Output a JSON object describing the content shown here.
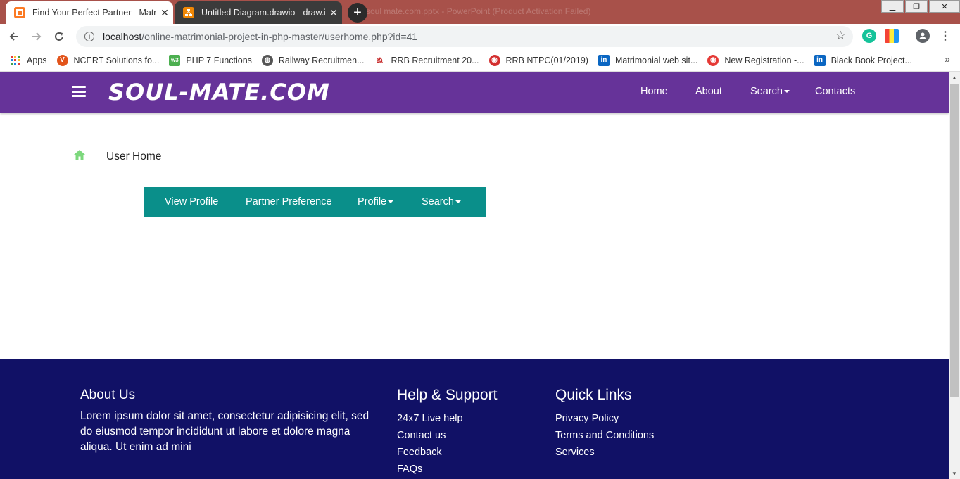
{
  "browser": {
    "tabs": [
      {
        "title": "Find Your Perfect Partner - Matri",
        "icon": "xampp-icon",
        "active": true
      },
      {
        "title": "Untitled Diagram.drawio - draw.i",
        "icon": "drawio-icon",
        "active": false
      }
    ],
    "background_window_title": "soul mate.com.pptx - PowerPoint (Product Activation Failed)",
    "url_host": "localhost",
    "url_path": "/online-matrimonial-project-in-php-master/userhome.php?id=41",
    "bookmarks": [
      {
        "label": "Apps",
        "icon": "apps-grid-icon"
      },
      {
        "label": "NCERT Solutions fo...",
        "icon": "ncert-icon",
        "color": "#e2541b"
      },
      {
        "label": "PHP 7 Functions",
        "icon": "w3-icon",
        "color": "#4caf50"
      },
      {
        "label": "Railway Recruitmen...",
        "icon": "globe-icon",
        "color": "#555555"
      },
      {
        "label": "RRB Recruitment 20...",
        "icon": "rrb-icon",
        "color": "#c62828"
      },
      {
        "label": "RRB NTPC(01/2019)",
        "icon": "rrb-ntpc-icon",
        "color": "#d32f2f"
      },
      {
        "label": "Matrimonial web sit...",
        "icon": "linkedin-icon",
        "color": "#0a66c2"
      },
      {
        "label": "New Registration -...",
        "icon": "registration-icon",
        "color": "#e53935"
      },
      {
        "label": "Black Book Project...",
        "icon": "linkedin-icon",
        "color": "#0a66c2"
      }
    ]
  },
  "site": {
    "brand": "SOUL-MATE.COM",
    "colors": {
      "header": "#663399",
      "subnav": "#0a8f8a",
      "footer": "#111166",
      "home_icon": "#7dd87d"
    },
    "nav": {
      "home": "Home",
      "about": "About",
      "search": "Search",
      "contacts": "Contacts"
    },
    "breadcrumb": {
      "current": "User Home"
    },
    "subnav": {
      "view_profile": "View Profile",
      "partner_preference": "Partner Preference",
      "profile": "Profile",
      "search": "Search"
    },
    "footer": {
      "about_title": "About Us",
      "about_text": "Lorem ipsum dolor sit amet, consectetur adipisicing elit, sed do eiusmod tempor incididunt ut labore et dolore magna aliqua. Ut enim ad mini",
      "help_title": "Help & Support",
      "help_links": [
        "24x7 Live help",
        "Contact us",
        "Feedback",
        "FAQs"
      ],
      "quick_title": "Quick Links",
      "quick_links": [
        "Privacy Policy",
        "Terms and Conditions",
        "Services"
      ]
    }
  }
}
